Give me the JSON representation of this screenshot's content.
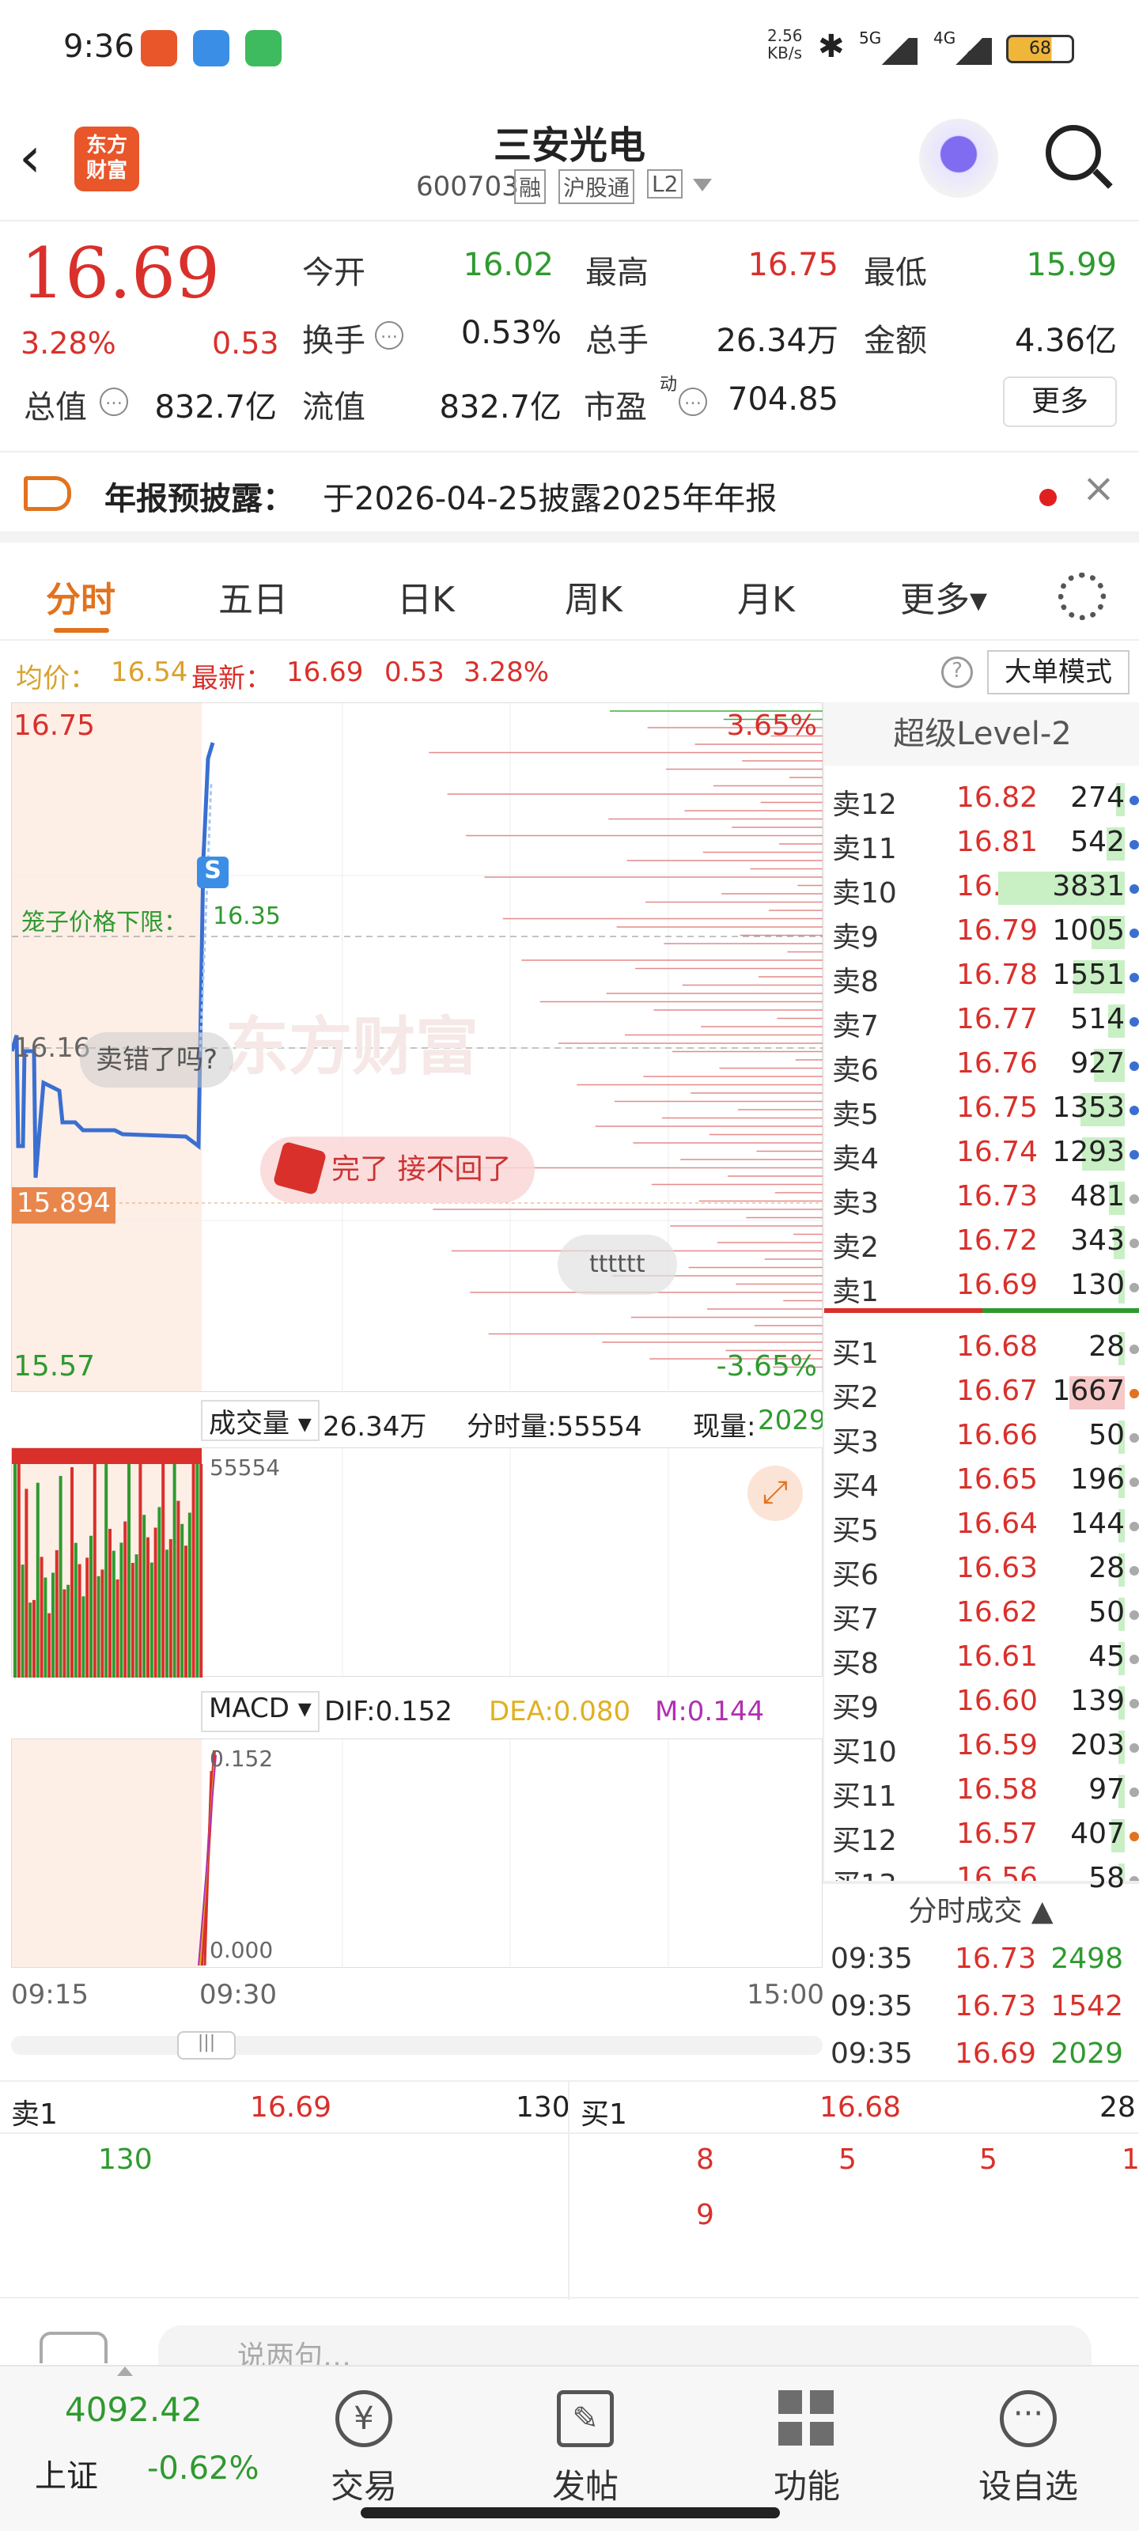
{
  "status": {
    "time": "9:36",
    "speed": "2.56\nKB/s",
    "net1": "5G",
    "net2": "4G",
    "battery": "68"
  },
  "header": {
    "logo": "东方\n财富",
    "title": "三安光电",
    "code": "600703",
    "tags": [
      "融",
      "沪股通",
      "L2"
    ]
  },
  "quote": {
    "price": "16.69",
    "pct": "3.28%",
    "chg": "0.53",
    "open_l": "今开",
    "open": "16.02",
    "high_l": "最高",
    "high": "16.75",
    "low_l": "最低",
    "low": "15.99",
    "turn_l": "换手",
    "turn": "0.53%",
    "vol_l": "总手",
    "vol": "26.34万",
    "amt_l": "金额",
    "amt": "4.36亿",
    "cap_l": "总值",
    "cap": "832.7亿",
    "flt_l": "流值",
    "flt": "832.7亿",
    "pe_l": "市盈",
    "pe_sup": "动",
    "pe": "704.85",
    "more": "更多"
  },
  "notice": {
    "label": "年报预披露：",
    "text": "于2026-04-25披露2025年年报"
  },
  "tabs": [
    "分时",
    "五日",
    "日K",
    "周K",
    "月K",
    "更多▾"
  ],
  "info": {
    "avg_l": "均价：",
    "avg": "16.54",
    "new_l": "最新：",
    "new": "16.69",
    "chg": "0.53",
    "pct": "3.28%",
    "mode": "大单模式"
  },
  "chart": {
    "top_price": "16.75",
    "top_pct": "3.65%",
    "bottom_price": "15.57",
    "bottom_pct": "-3.65%",
    "mid_price": "16.16",
    "lower_price": "15.894",
    "limit_l": "笼子价格下限：",
    "limit": "16.35",
    "bubble1": "卖错了吗?",
    "bubble2": "完了 接不回了",
    "bubble3": "tttttt",
    "watermark": "东方财富",
    "s_mark": "S",
    "vol_l": "成交量",
    "vol": "26.34万",
    "minvol": "分时量:55554",
    "curvol_l": "现量:",
    "curvol": "2029",
    "vol_axis": "55554",
    "macd_l": "MACD",
    "dif": "DIF:0.152",
    "dea": "DEA:0.080",
    "m": "M:0.144",
    "macd_top": "0.152",
    "macd_bot": "0.000",
    "t1": "09:15",
    "t2": "09:30",
    "t3": "15:00"
  },
  "book": {
    "title": "超级Level-2",
    "asks": [
      [
        "卖12",
        "16.82",
        "274"
      ],
      [
        "卖11",
        "16.81",
        "542"
      ],
      [
        "卖10",
        "16.80",
        "3831"
      ],
      [
        "卖9",
        "16.79",
        "1005"
      ],
      [
        "卖8",
        "16.78",
        "1551"
      ],
      [
        "卖7",
        "16.77",
        "514"
      ],
      [
        "卖6",
        "16.76",
        "927"
      ],
      [
        "卖5",
        "16.75",
        "1353"
      ],
      [
        "卖4",
        "16.74",
        "1293"
      ],
      [
        "卖3",
        "16.73",
        "481"
      ],
      [
        "卖2",
        "16.72",
        "343"
      ],
      [
        "卖1",
        "16.69",
        "130"
      ]
    ],
    "bids": [
      [
        "买1",
        "16.68",
        "28"
      ],
      [
        "买2",
        "16.67",
        "1667"
      ],
      [
        "买3",
        "16.66",
        "50"
      ],
      [
        "买4",
        "16.65",
        "196"
      ],
      [
        "买5",
        "16.64",
        "144"
      ],
      [
        "买6",
        "16.63",
        "28"
      ],
      [
        "买7",
        "16.62",
        "50"
      ],
      [
        "买8",
        "16.61",
        "45"
      ],
      [
        "买9",
        "16.60",
        "139"
      ],
      [
        "买10",
        "16.59",
        "203"
      ],
      [
        "买11",
        "16.58",
        "97"
      ],
      [
        "买12",
        "16.57",
        "407"
      ],
      [
        "买13",
        "16.56",
        "58"
      ]
    ],
    "trade_title": "分时成交",
    "trades": [
      [
        "09:35",
        "16.73",
        "2498"
      ],
      [
        "09:35",
        "16.73",
        "1542"
      ],
      [
        "09:35",
        "16.69",
        "2029"
      ]
    ]
  },
  "queue": {
    "s_l": "卖1",
    "s_p": "16.69",
    "s_v": "130",
    "b_l": "买1",
    "b_p": "16.68",
    "b_v": "28",
    "s_q": "130",
    "b_q": [
      "8",
      "5",
      "5",
      "1",
      "9"
    ]
  },
  "bottom": {
    "idx": "4092.42",
    "idx_name": "上证",
    "idx_pct": "-0.62%",
    "nav": [
      "交易",
      "发帖",
      "功能",
      "设自选"
    ],
    "input": "说两句…"
  }
}
